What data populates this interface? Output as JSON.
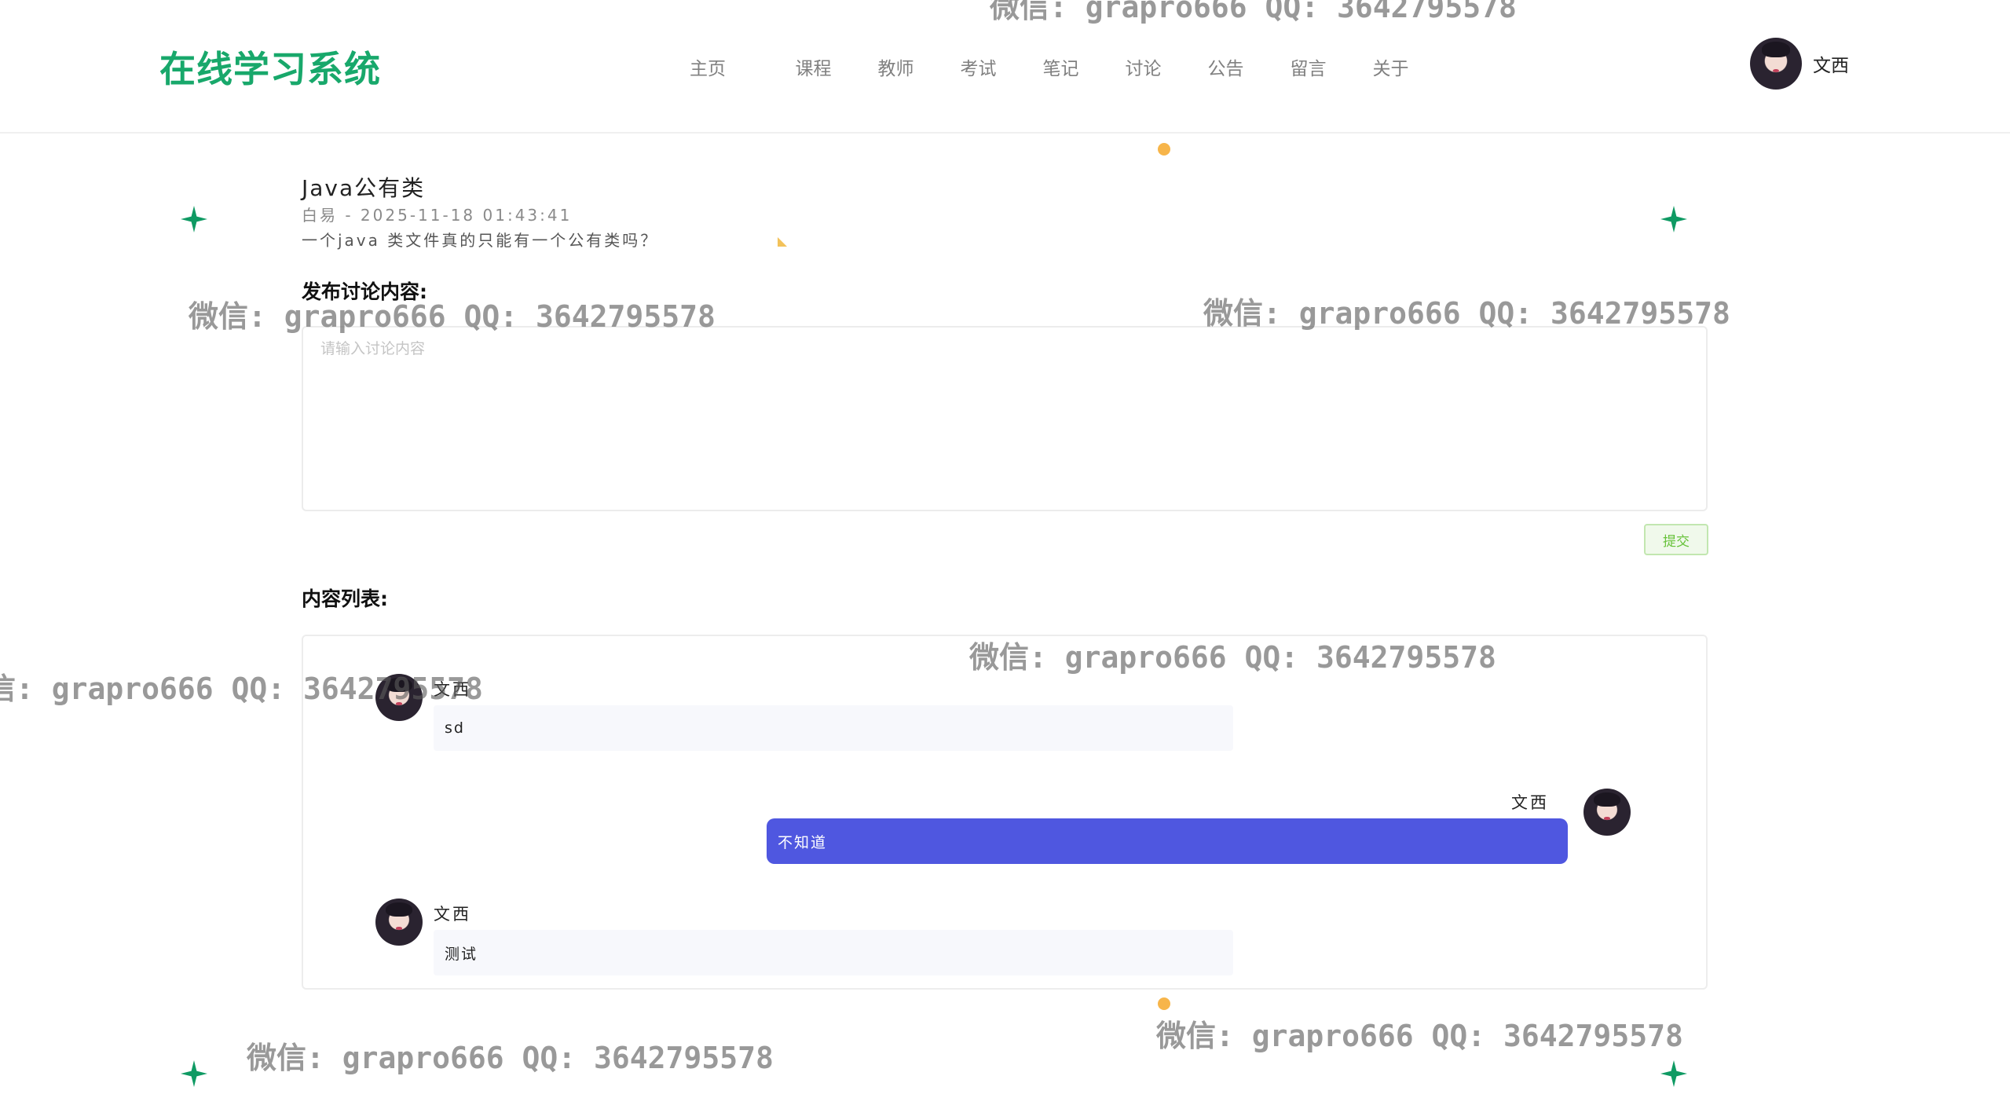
{
  "header": {
    "logo": "在线学习系统",
    "nav": [
      "主页",
      "课程",
      "教师",
      "考试",
      "笔记",
      "讨论",
      "公告",
      "留言",
      "关于"
    ],
    "user_name": "文西"
  },
  "post": {
    "title": "Java公有类",
    "meta": "白易 - 2025-11-18 01:43:41",
    "description": "一个java 类文件真的只能有一个公有类吗？"
  },
  "publish": {
    "label": "发布讨论内容:",
    "placeholder": "请输入讨论内容",
    "submit_label": "提交"
  },
  "list": {
    "label": "内容列表:",
    "messages": [
      {
        "user": "文西",
        "content": "sd",
        "side": "left"
      },
      {
        "user": "文西",
        "content": "不知道",
        "side": "right"
      },
      {
        "user": "文西",
        "content": "测试",
        "side": "left"
      }
    ]
  },
  "watermark": "微信: grapro666 QQ: 3642795578",
  "colors": {
    "brand": "#18a86b",
    "bubble_right": "#4f57e0",
    "submit_bg": "#f0f9eb",
    "submit_text": "#67c23a"
  }
}
